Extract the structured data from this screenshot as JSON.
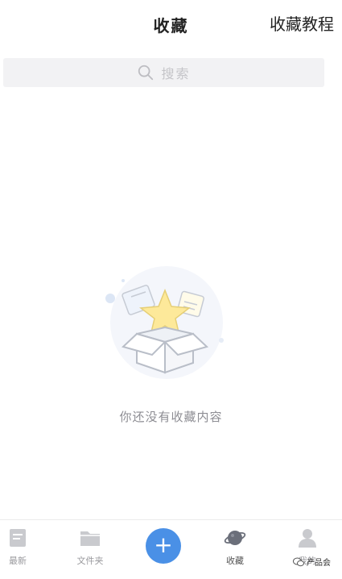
{
  "header": {
    "title": "收藏",
    "right_link": "收藏教程"
  },
  "search": {
    "placeholder": "搜索"
  },
  "empty_state": {
    "message": "你还没有收藏内容"
  },
  "tabbar": {
    "items": [
      {
        "label": "最新",
        "icon": "document-icon"
      },
      {
        "label": "文件夹",
        "icon": "folder-icon"
      },
      {
        "label": "+",
        "icon": "add-icon"
      },
      {
        "label": "收藏",
        "icon": "planet-icon"
      },
      {
        "label": "我的",
        "icon": "person-icon"
      }
    ]
  },
  "watermark": {
    "text": "产品会"
  },
  "colors": {
    "accent": "#4a90e6",
    "background": "#ffffff",
    "search_bg": "#f2f2f4",
    "muted_text": "#8d8d93"
  }
}
